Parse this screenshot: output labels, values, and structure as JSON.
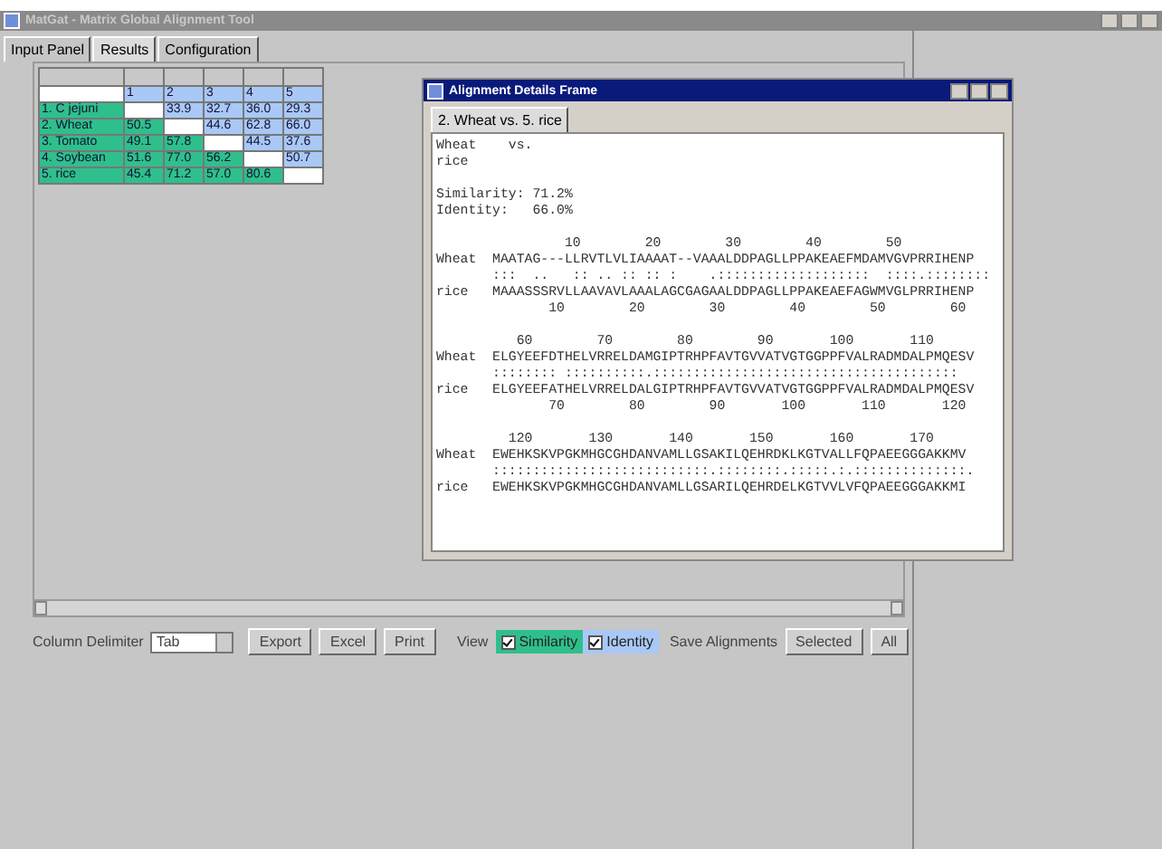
{
  "window": {
    "title": "MatGat - Matrix Global Alignment Tool",
    "tabs": [
      {
        "label": "Input Panel",
        "selected": false
      },
      {
        "label": "Results",
        "selected": true
      },
      {
        "label": "Configuration",
        "selected": false
      }
    ]
  },
  "matrix": {
    "columns": [
      "1",
      "2",
      "3",
      "4",
      "5"
    ],
    "rows": [
      {
        "label": "1. C jejuni",
        "values": [
          "33.9",
          "32.7",
          "36.0",
          "29.3"
        ]
      },
      {
        "label": "2. Wheat",
        "values": [
          "50.5",
          "44.6",
          "62.8",
          "66.0"
        ]
      },
      {
        "label": "3. Tomato",
        "values": [
          "49.1",
          "57.8",
          "44.5",
          "37.6"
        ]
      },
      {
        "label": "4. Soybean",
        "values": [
          "51.6",
          "77.0",
          "56.2",
          "50.7"
        ]
      },
      {
        "label": "5. rice",
        "values": [
          "45.4",
          "71.2",
          "57.0",
          "80.6"
        ]
      }
    ]
  },
  "toolbar": {
    "delimiter_label": "Column Delimiter",
    "delimiter": "Tab",
    "buttons": [
      "Export",
      "Excel",
      "Print"
    ],
    "view_label": "View",
    "view_options": [
      {
        "label": "Similarity",
        "checked": true,
        "color": "#2fbf8c"
      },
      {
        "label": "Identity",
        "checked": true,
        "color": "#a9c8f5"
      }
    ],
    "save_label": "Save Alignments",
    "save_buttons": [
      "Selected",
      "All"
    ]
  },
  "alignment_frame": {
    "title": "Alignment Details Frame",
    "tabs": [
      {
        "label": "2. Wheat vs. 5. rice",
        "selected": true
      }
    ],
    "header": [
      "Wheat    vs.",
      "rice"
    ],
    "stats": [
      "Similarity: 71.2%",
      "Identity:   66.0%"
    ],
    "blocks": [
      {
        "lines": [
          "                10        20        30        40        50",
          "Wheat  MAATAG---LLRVTLVLIAAAAT--VAAALDDPAGLLPPAKEAEFMDAMVGVPRRIHENP",
          "       :::  ..   :: .. :: :: :    .:::::::::::::::::::  ::::.::::::::",
          "rice   MAAASSSRVLLAAVAVLAAALAGCGAGAALDDPAGLLPPAKEAEFAGWMVGLPRRIHENP",
          "              10        20        30        40        50        60"
        ]
      },
      {
        "lines": [
          "          60        70        80        90       100       110",
          "Wheat  ELGYEEFDTHELVRRELDAMGIPTRHPFAVTGVVATVGTGGPPFVALRADMDALPMQESV",
          "       :::::::: ::::::::::.::::::::::::::::::::::::::::::::::::::",
          "rice   ELGYEEFATHELVRRELDALGIPTRHPFAVTGVVATVGTGGPPFVALRADMDALPMQESV",
          "              70        80        90       100       110       120"
        ]
      },
      {
        "lines": [
          "         120       130       140       150       160       170",
          "Wheat  EWEHKSKVPGKMHGCGHDANVAMLLGSAKILQEHRDKLKGTVALLFQPAEEGGGAKKMV",
          "       :::::::::::::::::::::::::::.::::::::.:::::.:.::::::::::::::.",
          "rice   EWEHKSKVPGKMHGCGHDANVAMLLGSARILQEHRDELKGTVVLVFQPAEEGGGAKKMI"
        ]
      }
    ]
  }
}
